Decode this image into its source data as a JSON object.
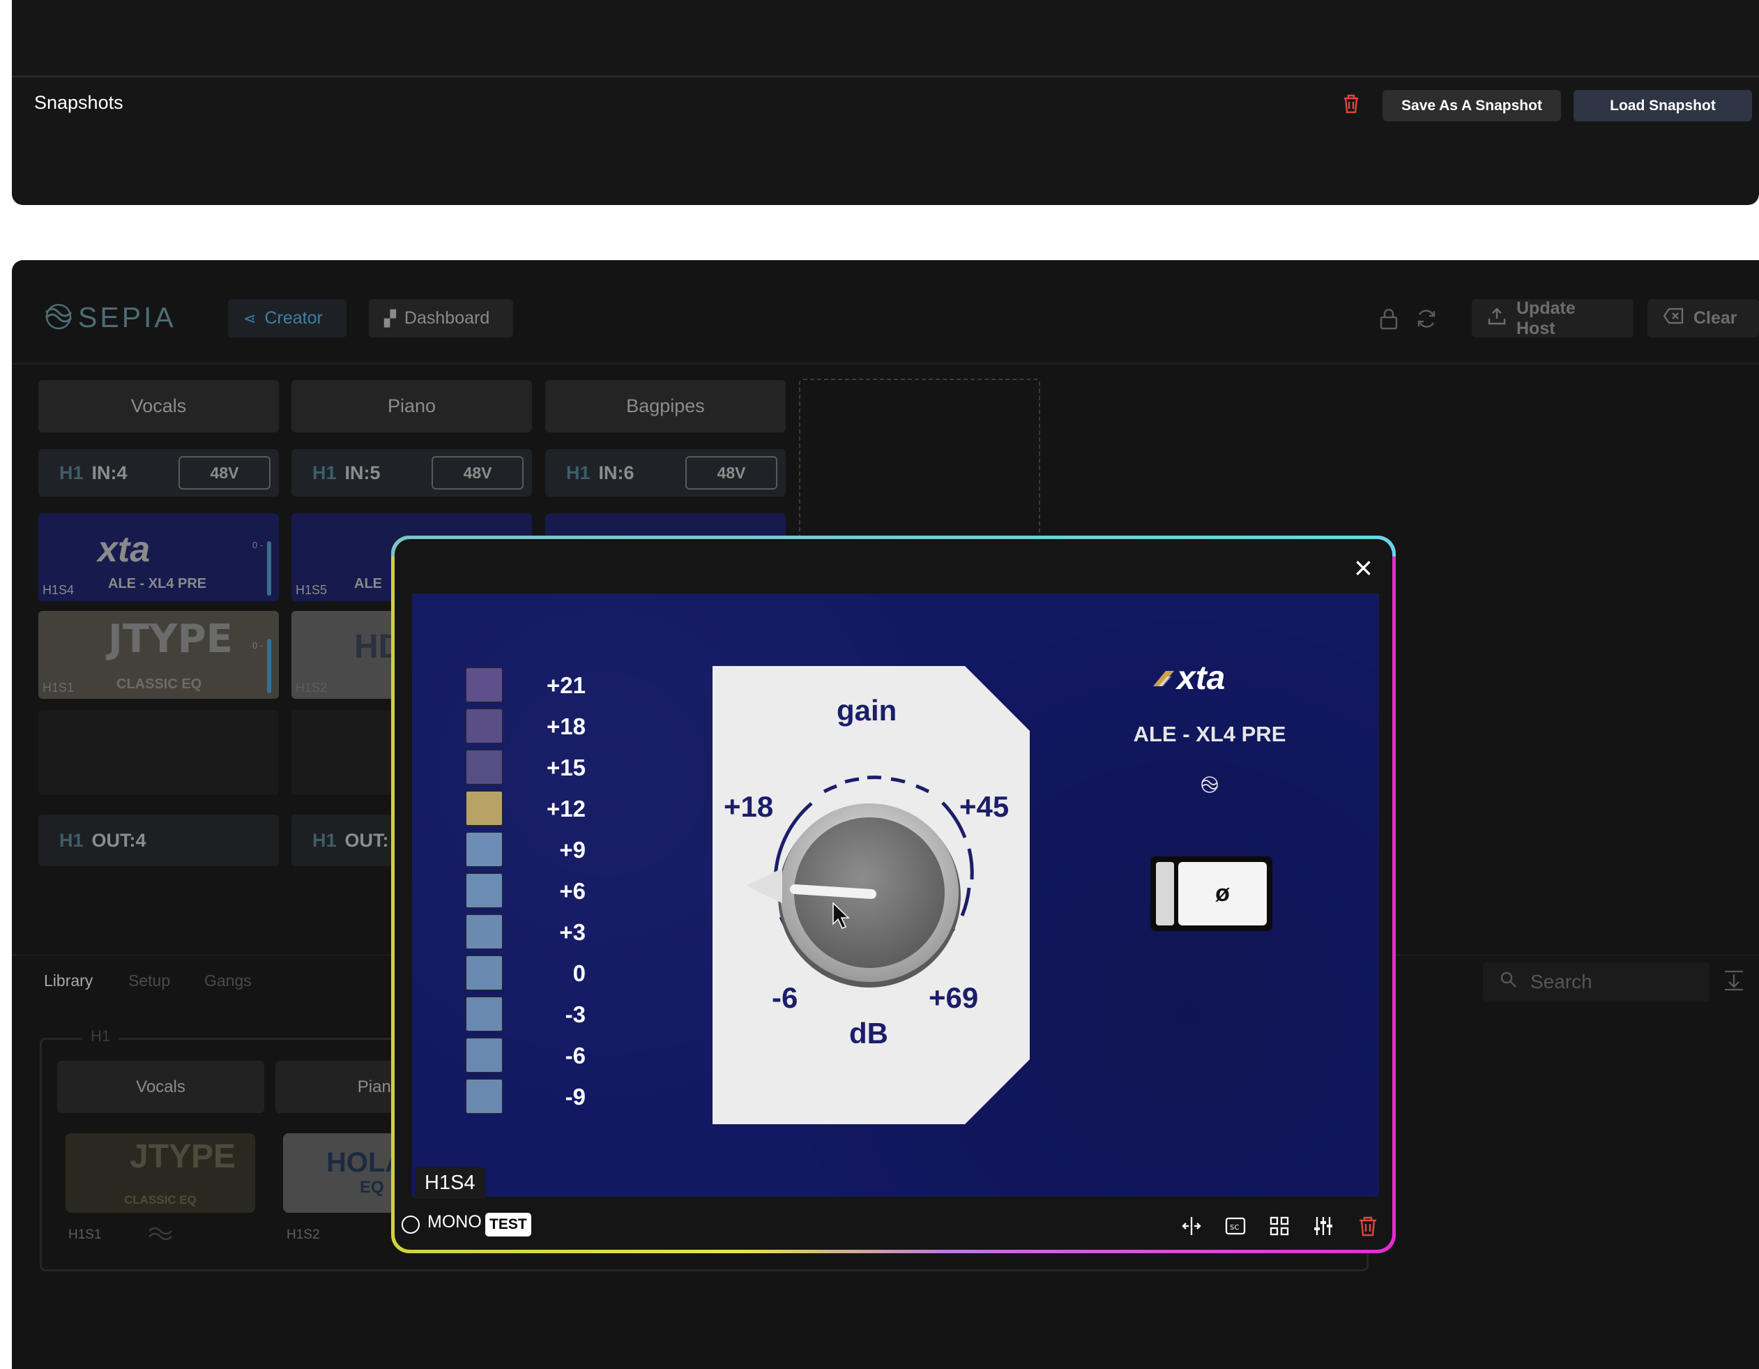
{
  "snapshots": {
    "title": "Snapshots",
    "save_label": "Save As A Snapshot",
    "load_label": "Load Snapshot"
  },
  "header": {
    "logo": "SEPIA",
    "nav": [
      {
        "label": "Creator",
        "active": true
      },
      {
        "label": "Dashboard",
        "active": false
      }
    ],
    "update_label": "Update Host",
    "clear_label": "Clear"
  },
  "tracks": [
    {
      "name": "Vocals",
      "host": "H1",
      "input": "IN:4",
      "phantom": "48V",
      "output": "OUT:4"
    },
    {
      "name": "Piano",
      "host": "H1",
      "input": "IN:5",
      "phantom": "48V",
      "output": "OUT:"
    },
    {
      "name": "Bagpipes",
      "host": "H1",
      "input": "IN:6",
      "phantom": "48V"
    }
  ],
  "tiles": {
    "xta": {
      "brand": "xta",
      "model": "ALE - XL4 PRE",
      "slot_1": "H1S4",
      "slot_2": "H1S5",
      "model_partial": "ALE"
    },
    "jtype": {
      "brand": "JTYPE",
      "model": "CLASSIC EQ",
      "slot": "H1S1"
    },
    "hd": {
      "brand": "HD",
      "slot": "H1S2"
    },
    "meter_zero": "0 -"
  },
  "library": {
    "tabs": [
      "Library",
      "Setup",
      "Gangs"
    ],
    "search_placeholder": "Search",
    "group_label": "H1",
    "tracks": [
      "Vocals",
      "Piano"
    ],
    "cards": [
      {
        "brand": "JTYPE",
        "model": "CLASSIC EQ",
        "slot": "H1S1"
      },
      {
        "brand": "HOLA",
        "model": "EQ",
        "slot": "H1S2"
      }
    ]
  },
  "modal": {
    "close_symbol": "×",
    "meter_labels": [
      "+21",
      "+18",
      "+15",
      "+12",
      "+9",
      "+6",
      "+3",
      "0",
      "-3",
      "-6",
      "-9"
    ],
    "meter_colors": [
      "#5f4f8a",
      "#5a4e86",
      "#554f86",
      "#b9a266",
      "#6d8db6",
      "#6b8cb4",
      "#6a8ab2",
      "#6a8ab1",
      "#6a89b0",
      "#6a89b0",
      "#6a89b0"
    ],
    "knob": {
      "title": "gain",
      "unit": "dB",
      "label_tl": "+18",
      "label_tr": "+45",
      "label_bl": "-6",
      "label_br": "+69"
    },
    "brand": "xta",
    "model": "ALE - XL4 PRE",
    "phase_symbol": "ø",
    "slot": "H1S4",
    "mono_label": "MONO",
    "test_label": "TEST"
  }
}
